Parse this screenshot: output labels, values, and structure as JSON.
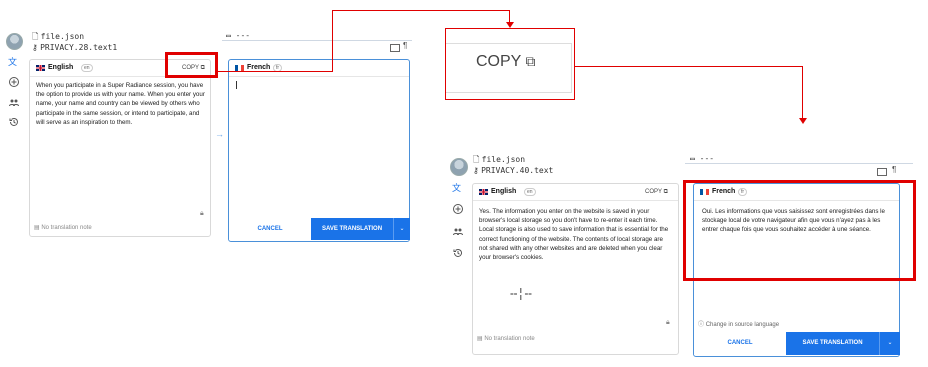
{
  "screen1": {
    "file_name": "file.json",
    "file_path": "PRIVACY.28.text1",
    "dashes": "---",
    "source": {
      "lang": "English",
      "code": "en",
      "copy_label": "COPY",
      "text": "When you participate in a Super Radiance session, you have the option to provide us with your name. When you enter your name, your name and country can be viewed by others who participate in the same session, or intend to participate, and will serve as an inspiration to them.",
      "note": "No translation note"
    },
    "target": {
      "lang": "French",
      "code": "fr",
      "text": "",
      "cancel": "CANCEL",
      "save": "SAVE TRANSLATION"
    }
  },
  "zoom": {
    "copy_label": "COPY"
  },
  "screen2": {
    "file_name": "file.json",
    "file_path": "PRIVACY.40.text",
    "dashes": "---",
    "source": {
      "lang": "English",
      "code": "en",
      "copy_label": "COPY",
      "text": "Yes. The information you enter on the website is saved in your browser's local storage so you don't have to re-enter it each time. Local storage is also used to save information that is essential for the correct functioning of the website. The contents of local storage are not shared with any other websites and are deleted when you clear your browser's cookies.",
      "note": "No translation note"
    },
    "target": {
      "lang": "French",
      "code": "fr",
      "text": "Oui. Les informations que vous saisissez sont enregistrées dans le stockage local de votre navigateur afin que vous n'ayez pas à les entrer chaque fois que vous souhaitez accéder à une séance.",
      "change_source": "Change in source language",
      "cancel": "CANCEL",
      "save": "SAVE TRANSLATION"
    }
  },
  "colors": {
    "accent": "#1a73e8",
    "highlight": "#e00000"
  }
}
